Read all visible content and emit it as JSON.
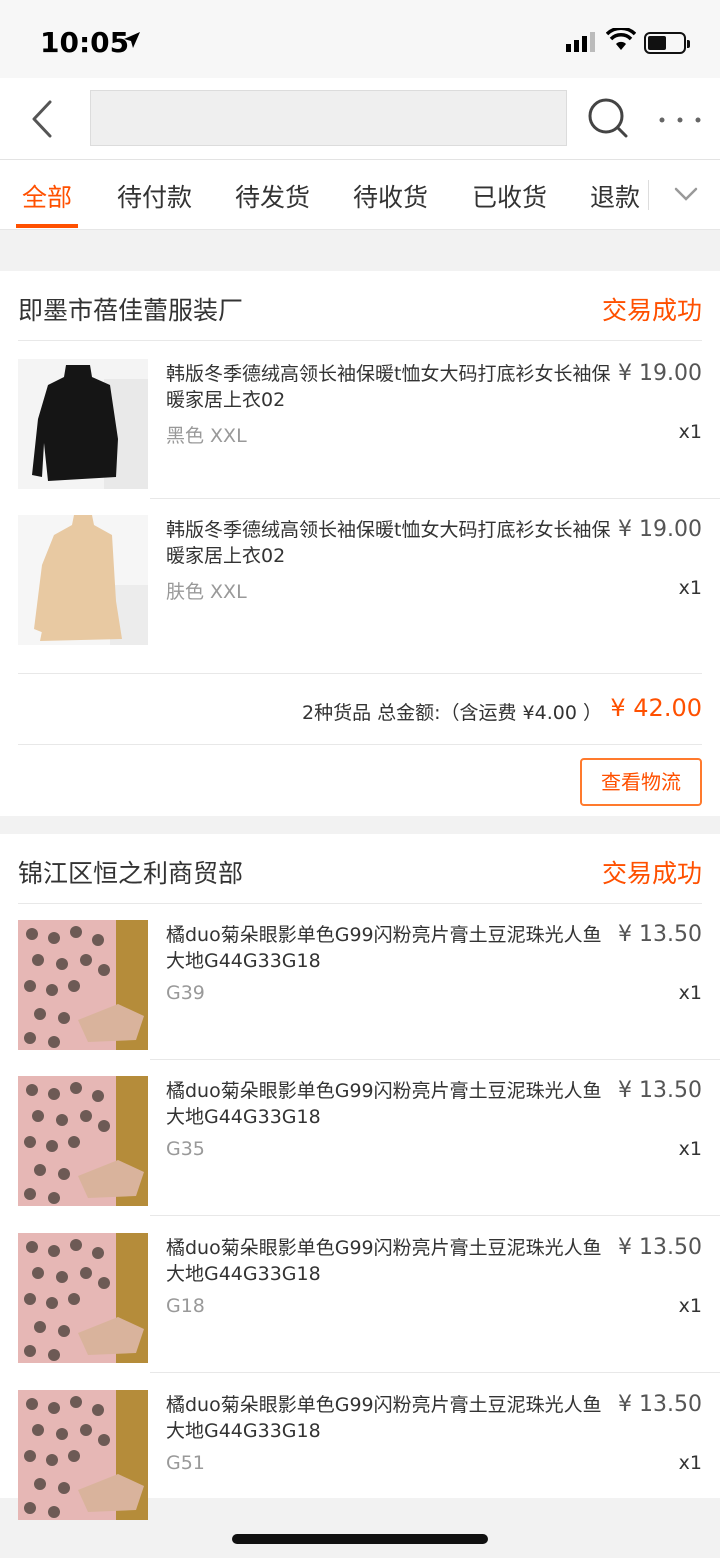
{
  "status_bar": {
    "time": "10:05"
  },
  "search": {
    "value": "",
    "placeholder": ""
  },
  "tabs": [
    {
      "label": "全部",
      "active": true
    },
    {
      "label": "待付款",
      "active": false
    },
    {
      "label": "待发货",
      "active": false
    },
    {
      "label": "待收货",
      "active": false
    },
    {
      "label": "已收货",
      "active": false
    },
    {
      "label": "退款",
      "active": false
    }
  ],
  "orders": [
    {
      "shop": "即墨市蓓佳蕾服装厂",
      "status": "交易成功",
      "items": [
        {
          "title": "韩版冬季德绒高领长袖保暖t恤女大码打底衫女长袖保暖家居上衣02",
          "price": "¥ 19.00",
          "sku": "黑色 XXL",
          "qty": "x1"
        },
        {
          "title": "韩版冬季德绒高领长袖保暖t恤女大码打底衫女长袖保暖家居上衣02",
          "price": "¥ 19.00",
          "sku": "肤色 XXL",
          "qty": "x1"
        }
      ],
      "summary": "2种货品 总金额:（含运费 ¥4.00 ）",
      "total": "¥ 42.00",
      "logistics_label": "查看物流"
    },
    {
      "shop": "锦江区恒之利商贸部",
      "status": "交易成功",
      "items": [
        {
          "title": "橘duo菊朵眼影单色G99闪粉亮片膏土豆泥珠光人鱼大地G44G33G18",
          "price": "¥ 13.50",
          "sku": "G39",
          "qty": "x1"
        },
        {
          "title": "橘duo菊朵眼影单色G99闪粉亮片膏土豆泥珠光人鱼大地G44G33G18",
          "price": "¥ 13.50",
          "sku": "G35",
          "qty": "x1"
        },
        {
          "title": "橘duo菊朵眼影单色G99闪粉亮片膏土豆泥珠光人鱼大地G44G33G18",
          "price": "¥ 13.50",
          "sku": "G18",
          "qty": "x1"
        },
        {
          "title": "橘duo菊朵眼影单色G99闪粉亮片膏土豆泥珠光人鱼大地G44G33G18",
          "price": "¥ 13.50",
          "sku": "G51",
          "qty": "x1"
        }
      ]
    }
  ],
  "colors": {
    "accent": "#ff5000",
    "sweater_black": "#151515",
    "sweater_beige": "#e8c9a2",
    "eyeshadow_pink": "#e6b7b5"
  }
}
